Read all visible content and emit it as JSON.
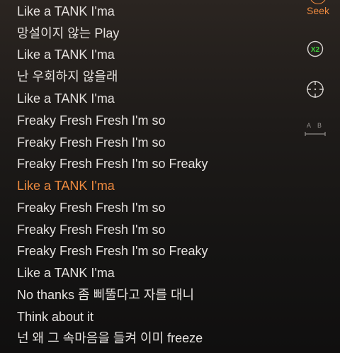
{
  "controls": {
    "seek_label": "Seek",
    "speed_label": "X2",
    "ab_label": "A B",
    "accent_color": "#ee8a3f"
  },
  "lyrics": [
    {
      "text": "Like a TANK I'ma",
      "active": false
    },
    {
      "text": "망설이지 않는 Play",
      "active": false
    },
    {
      "text": "Like a TANK I'ma",
      "active": false
    },
    {
      "text": "난 우회하지 않을래",
      "active": false
    },
    {
      "text": "Like a TANK I'ma",
      "active": false
    },
    {
      "text": "Freaky Fresh Fresh I'm so",
      "active": false
    },
    {
      "text": "Freaky Fresh Fresh I'm so",
      "active": false
    },
    {
      "text": "Freaky Fresh Fresh I'm so Freaky",
      "active": false
    },
    {
      "text": "Like a TANK I'ma",
      "active": true
    },
    {
      "text": "Freaky Fresh Fresh I'm so",
      "active": false
    },
    {
      "text": "Freaky Fresh Fresh I'm so",
      "active": false
    },
    {
      "text": "Freaky Fresh Fresh I'm so Freaky",
      "active": false
    },
    {
      "text": "Like a TANK I'ma",
      "active": false
    },
    {
      "text": "No thanks 좀 삐뚤다고 자를 대니",
      "active": false
    },
    {
      "text": "Think about it",
      "active": false
    },
    {
      "text": "넌 왜 그 속마음을 들켜 이미 freeze",
      "active": false
    }
  ]
}
